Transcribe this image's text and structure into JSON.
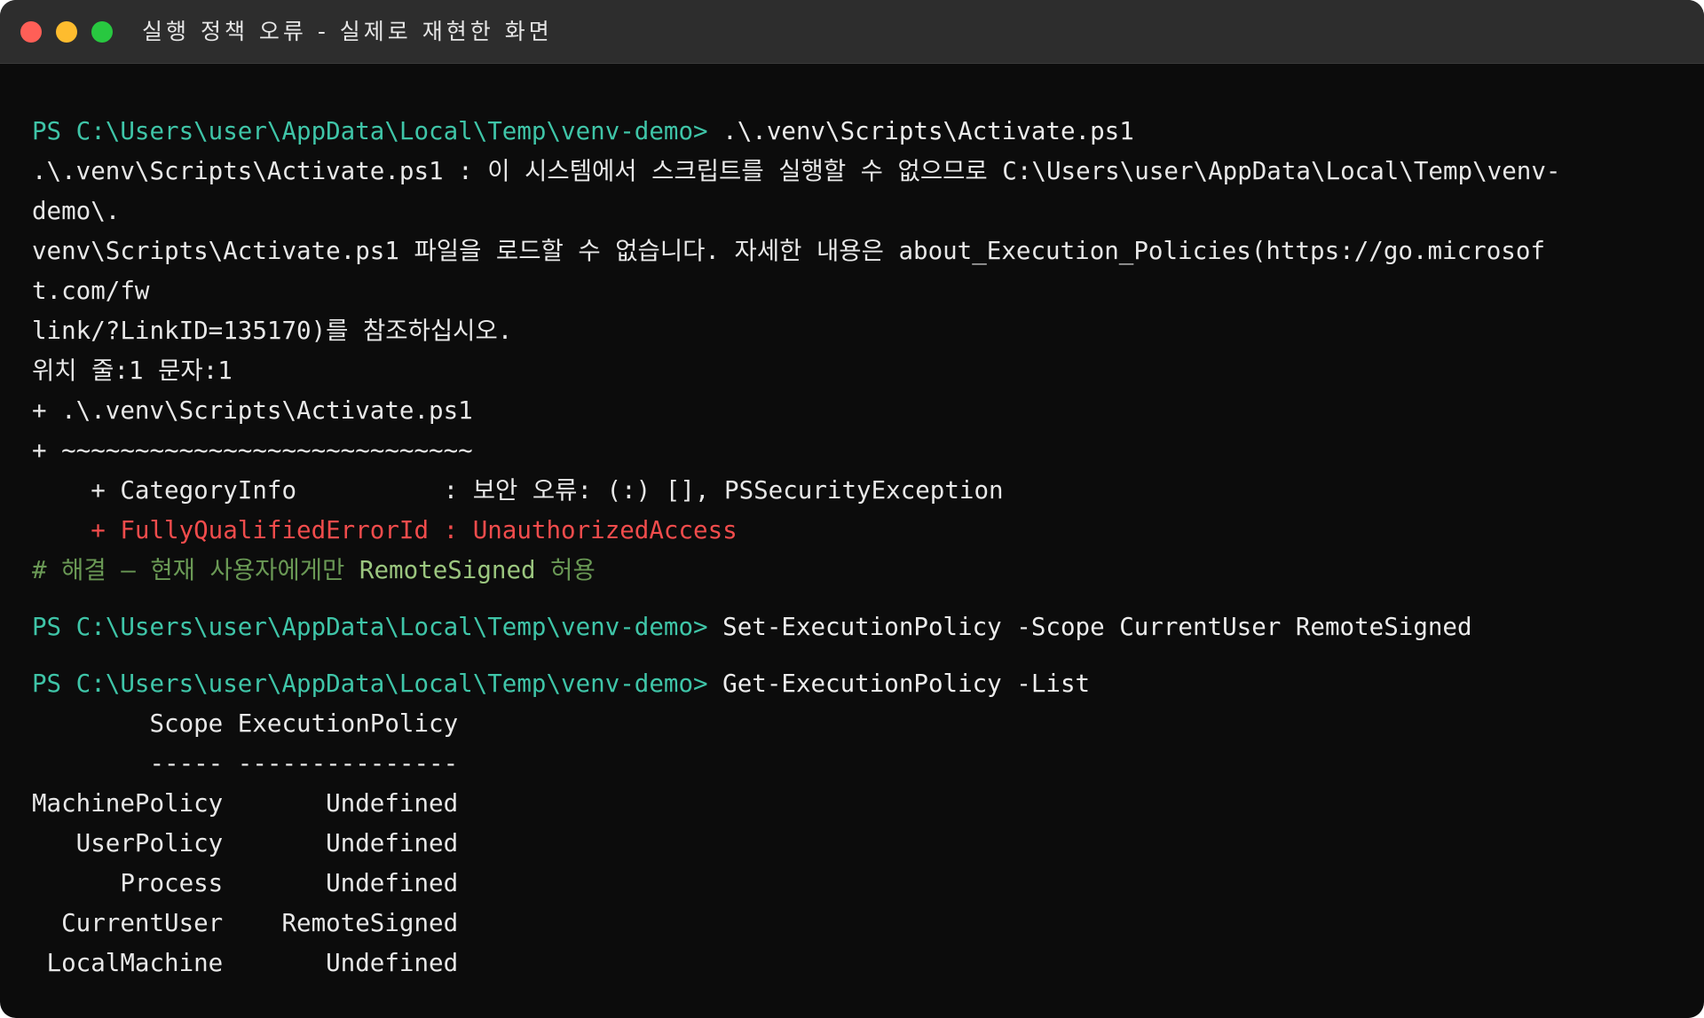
{
  "window": {
    "title": "실행 정책 오류 - 실제로 재현한 화면"
  },
  "terminal": {
    "prompt": "PS C:\\Users\\user\\AppData\\Local\\Temp\\venv-demo>",
    "block1": {
      "command": " .\\.venv\\Scripts\\Activate.ps1",
      "error_lines": [
        ".\\.venv\\Scripts\\Activate.ps1 : 이 시스템에서 스크립트를 실행할 수 없으므로 C:\\Users\\user\\AppData\\Local\\Temp\\venv-",
        "demo\\.",
        "venv\\Scripts\\Activate.ps1 파일을 로드할 수 없습니다. 자세한 내용은 about_Execution_Policies(https://go.microsof",
        "t.com/fw",
        "link/?LinkID=135170)를 참조하십시오.",
        "위치 줄:1 문자:1",
        "+ .\\.venv\\Scripts\\Activate.ps1",
        "+ ~~~~~~~~~~~~~~~~~~~~~~~~~~~~",
        "    + CategoryInfo          : 보안 오류: (:) [], PSSecurityException"
      ],
      "error_id_line": "    + FullyQualifiedErrorId : UnauthorizedAccess"
    },
    "comment": {
      "before": "# 해결 — 현재 사용자에게만 ",
      "highlight": "RemoteSigned",
      "after": " 허용"
    },
    "block2": {
      "command": " Set-ExecutionPolicy -Scope CurrentUser RemoteSigned"
    },
    "block3": {
      "command": " Get-ExecutionPolicy -List",
      "table_header": "        Scope ExecutionPolicy",
      "table_sep": "        ----- ---------------",
      "rows": [
        "MachinePolicy       Undefined",
        "   UserPolicy       Undefined",
        "      Process       Undefined",
        "  CurrentUser    RemoteSigned",
        " LocalMachine       Undefined"
      ]
    }
  },
  "colors": {
    "prompt": "#3fc5a8",
    "error": "#f14c4c",
    "comment": "#6a9955",
    "background": "#0c0c0c"
  }
}
